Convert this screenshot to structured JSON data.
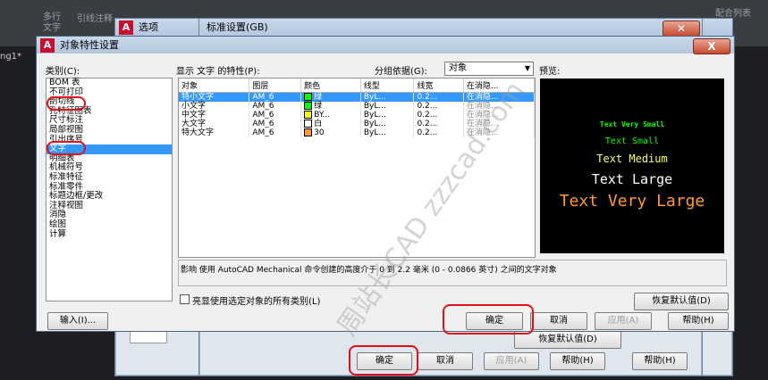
{
  "toolbar": {
    "items": [
      "多行",
      "文字",
      "引线注释",
      "配合列表"
    ]
  },
  "drawing_tab": "ng1*",
  "back_dialog_1": {
    "title": "选项"
  },
  "back_dialog_2": {
    "title": "标准设置(GB)",
    "restore_label": "恢复默认值(D)",
    "ok_label": "确定",
    "cancel_label": "取消",
    "apply_label": "应用(A)",
    "help_label": "帮助(H)"
  },
  "main_dialog": {
    "title": "对象特性设置",
    "close_label": "X",
    "category_label": "类别(C):",
    "categories": [
      "BOM 表",
      "不可打印",
      "剖切线",
      "孔特征图表",
      "尺寸标注",
      "局部视图",
      "引出序号",
      "文字",
      "明细表",
      "机械符号",
      "标准特征",
      "标准零件",
      "标题边框/更改",
      "注释视图",
      "消隐",
      "绘图",
      "计算"
    ],
    "properties_label": "显示 文字 的特性(P):",
    "group_by_label": "分组依据(G):",
    "group_by_value": "对象",
    "preview_label": "预览:",
    "table": {
      "headers": [
        "对象",
        "图层",
        "颜色",
        "线型",
        "线宽",
        "在消隐..."
      ],
      "rows": [
        {
          "obj": "特小文字",
          "layer": "AM_6",
          "color_name": "绿",
          "color": "#00ff00",
          "linetype": "ByL...",
          "lineweight": "0.2...",
          "hidden": "在消隐..."
        },
        {
          "obj": "小文字",
          "layer": "AM_6",
          "color_name": "绿",
          "color": "#00ff00",
          "linetype": "ByL...",
          "lineweight": "0.2...",
          "hidden": "在消隐..."
        },
        {
          "obj": "中文字",
          "layer": "AM_6",
          "color_name": "BY...",
          "color": "#ffff00",
          "linetype": "ByL...",
          "lineweight": "0.2...",
          "hidden": "在消隐..."
        },
        {
          "obj": "大文字",
          "layer": "AM_6",
          "color_name": "白",
          "color": "#ffffff",
          "linetype": "ByL...",
          "lineweight": "0.2...",
          "hidden": "在消隐..."
        },
        {
          "obj": "特大文字",
          "layer": "AM_6",
          "color_name": "30",
          "color": "#ff9933",
          "linetype": "ByL...",
          "lineweight": "0.2...",
          "hidden": "在消隐..."
        }
      ]
    },
    "preview_texts": [
      {
        "text": "Text Very Small",
        "color": "#00ff00"
      },
      {
        "text": "Text Small",
        "color": "#00ff00"
      },
      {
        "text": "Text Medium",
        "color": "#ffff66"
      },
      {
        "text": "Text Large",
        "color": "#ffffff"
      },
      {
        "text": "Text Very Large",
        "color": "#ff9933"
      }
    ],
    "description": "影响 使用 AutoCAD Mechanical 命令创建的高度介于 0 到 2.2 毫米 (0 - 0.0866 英寸) 之间的文字对象",
    "highlight_checkbox_label": "亮显使用选定对象的所有类别(L)",
    "restore_label": "恢复默认值(D)",
    "input_label": "输入(I)...",
    "ok_label": "确定",
    "cancel_label": "取消",
    "apply_label": "应用(A)",
    "help_label": "帮助(H)"
  },
  "watermark": "周站长CAD zzzcad.com"
}
